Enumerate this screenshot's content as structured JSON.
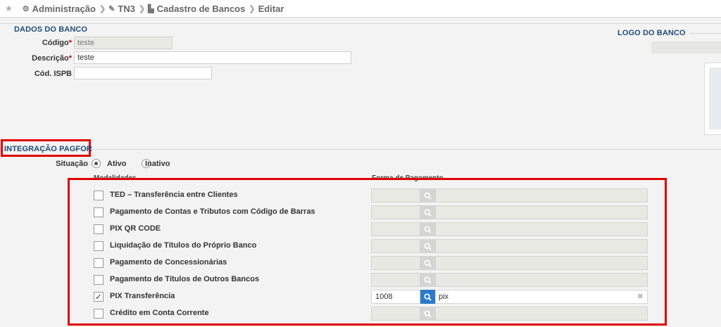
{
  "breadcrumb": {
    "items": [
      {
        "label": "Administração",
        "icon": "gears-icon"
      },
      {
        "label": "TN3",
        "icon": "pin-icon"
      },
      {
        "label": "Cadastro de Bancos",
        "icon": "bank-icon"
      },
      {
        "label": "Editar",
        "icon": ""
      }
    ]
  },
  "dados_banco": {
    "title": "DADOS DO BANCO",
    "codigo_label": "Código",
    "codigo_value": "teste",
    "descricao_label": "Descrição",
    "descricao_value": "teste",
    "isbp_label": "Cód. ISPB",
    "isbp_value": "",
    "required_mark": "*"
  },
  "logo": {
    "title": "LOGO DO BANCO"
  },
  "integracao": {
    "title": "INTEGRAÇÃO PAGFOR",
    "situacao_label": "Situação",
    "options": [
      {
        "label": "Ativo",
        "selected": true
      },
      {
        "label": "Inativo",
        "selected": false
      }
    ],
    "col_modalidades": "Modalidades",
    "col_forma": "Forma de Pagamento",
    "rows": [
      {
        "label": "TED – Transferência entre Clientes",
        "checked": false,
        "code": "",
        "desc": ""
      },
      {
        "label": "Pagamento de Contas e Tributos com Código de Barras",
        "checked": false,
        "code": "",
        "desc": ""
      },
      {
        "label": "PIX QR CODE",
        "checked": false,
        "code": "",
        "desc": ""
      },
      {
        "label": "Liquidação de Títulos do Próprio Banco",
        "checked": false,
        "code": "",
        "desc": ""
      },
      {
        "label": "Pagamento de Concessionárias",
        "checked": false,
        "code": "",
        "desc": ""
      },
      {
        "label": "Pagamento de Títulos de Outros Bancos",
        "checked": false,
        "code": "",
        "desc": ""
      },
      {
        "label": "PIX Transferência",
        "checked": true,
        "code": "1008",
        "desc": "pix"
      },
      {
        "label": "Crédito em Conta Corrente",
        "checked": false,
        "code": "",
        "desc": ""
      }
    ]
  },
  "colors": {
    "accent": "#2a7ac9",
    "section_title": "#1f4e79",
    "highlight": "#e00000"
  }
}
